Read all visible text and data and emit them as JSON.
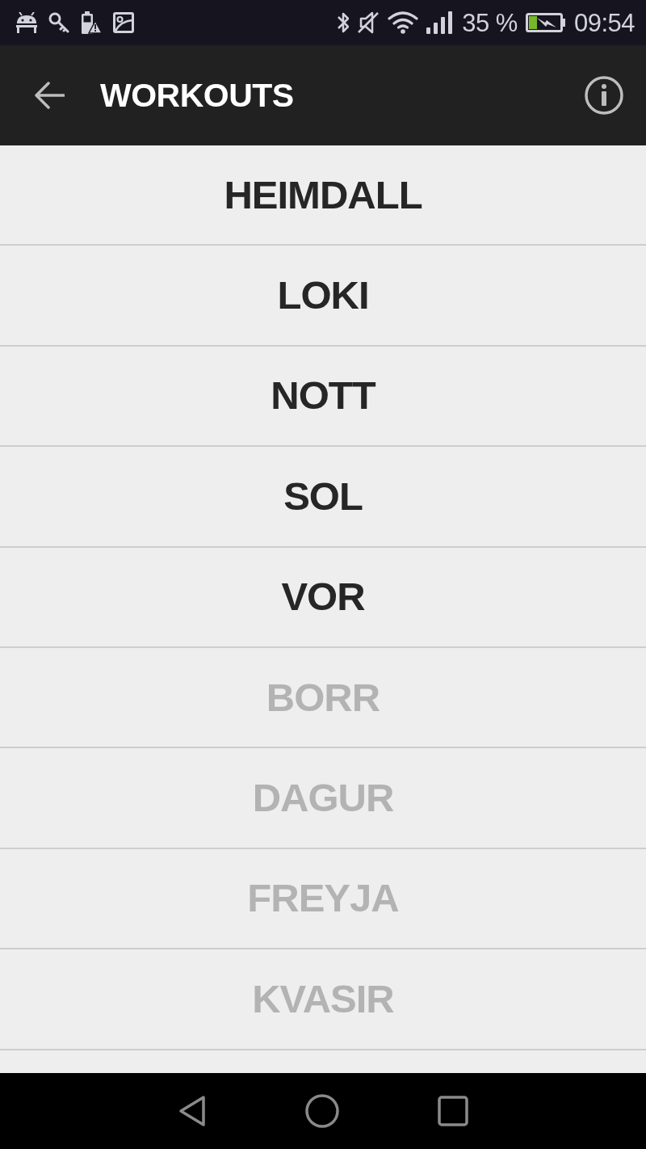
{
  "status_bar": {
    "battery_text": "35 %",
    "time": "09:54"
  },
  "app_bar": {
    "title": "WORKOUTS"
  },
  "workouts": [
    {
      "name": "HEIMDALL",
      "disabled": false
    },
    {
      "name": "LOKI",
      "disabled": false
    },
    {
      "name": "NOTT",
      "disabled": false
    },
    {
      "name": "SOL",
      "disabled": false
    },
    {
      "name": "VOR",
      "disabled": false
    },
    {
      "name": "BORR",
      "disabled": true
    },
    {
      "name": "DAGUR",
      "disabled": true
    },
    {
      "name": "FREYJA",
      "disabled": true
    },
    {
      "name": "KVASIR",
      "disabled": true
    }
  ]
}
